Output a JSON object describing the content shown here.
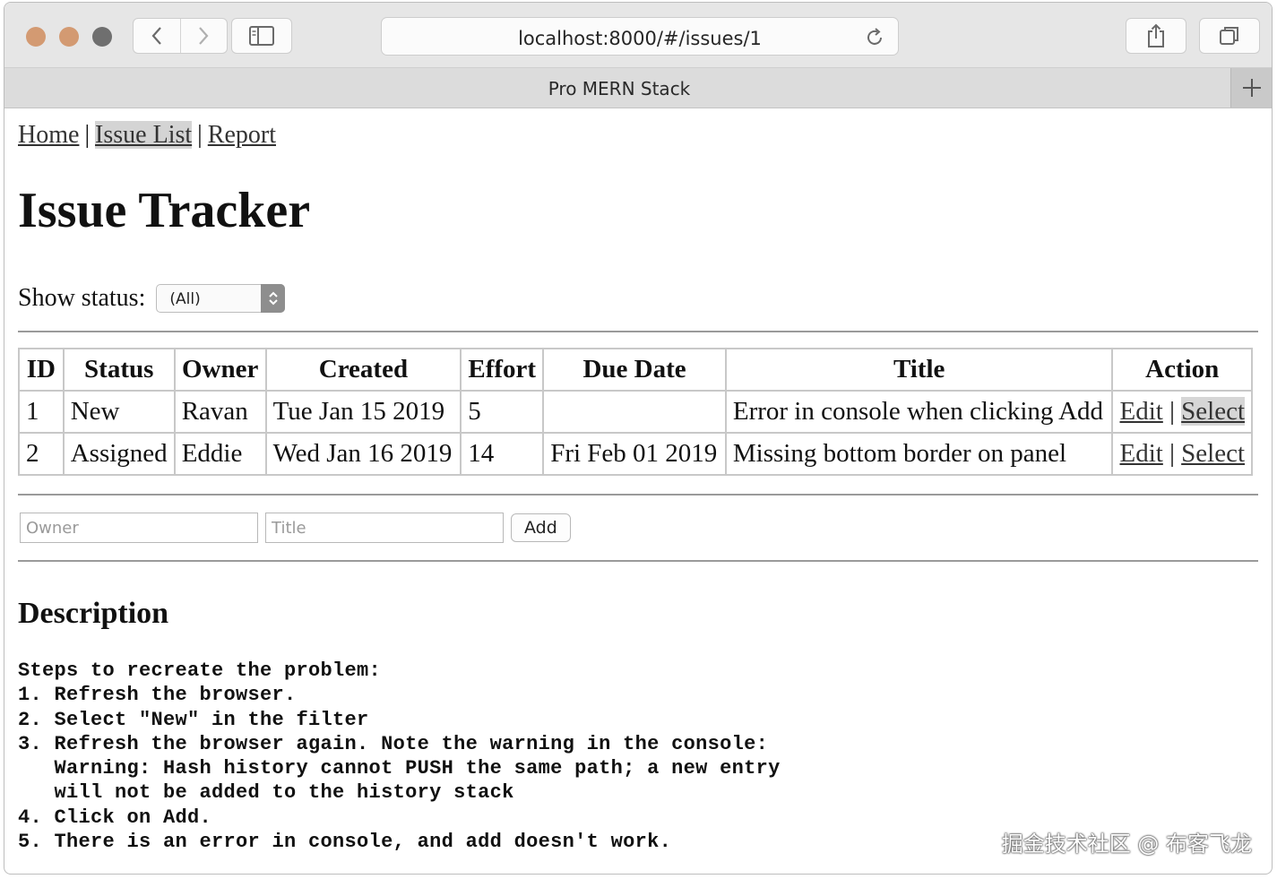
{
  "browser": {
    "url": "localhost:8000/#/issues/1",
    "tab_title": "Pro MERN Stack"
  },
  "nav": {
    "home": "Home",
    "separator1": "|",
    "issue_list": "Issue List",
    "separator2": "|",
    "report": "Report"
  },
  "page": {
    "title": "Issue Tracker"
  },
  "filter": {
    "label": "Show status:",
    "selected": "(All)"
  },
  "table": {
    "headers": [
      "ID",
      "Status",
      "Owner",
      "Created",
      "Effort",
      "Due Date",
      "Title",
      "Action"
    ],
    "rows": [
      {
        "id": "1",
        "status": "New",
        "owner": "Ravan",
        "created": "Tue Jan 15 2019",
        "effort": "5",
        "due": "",
        "title": "Error in console when clicking Add",
        "edit": "Edit",
        "sep": "|",
        "select": "Select"
      },
      {
        "id": "2",
        "status": "Assigned",
        "owner": "Eddie",
        "created": "Wed Jan 16 2019",
        "effort": "14",
        "due": "Fri Feb 01 2019",
        "title": "Missing bottom border on panel",
        "edit": "Edit",
        "sep": "|",
        "select": "Select"
      }
    ]
  },
  "add_form": {
    "owner_placeholder": "Owner",
    "title_placeholder": "Title",
    "add_label": "Add"
  },
  "description": {
    "heading": "Description",
    "body": "Steps to recreate the problem:\n1. Refresh the browser.\n2. Select \"New\" in the filter\n3. Refresh the browser again. Note the warning in the console:\n   Warning: Hash history cannot PUSH the same path; a new entry\n   will not be added to the history stack\n4. Click on Add.\n5. There is an error in console, and add doesn't work."
  },
  "watermark": "掘金技术社区 @ 布客飞龙",
  "colors": {
    "traffic_light": "#d39a72",
    "toolbar_bg": "#e6e6e6",
    "selected_highlight": "#d4d4d4"
  }
}
